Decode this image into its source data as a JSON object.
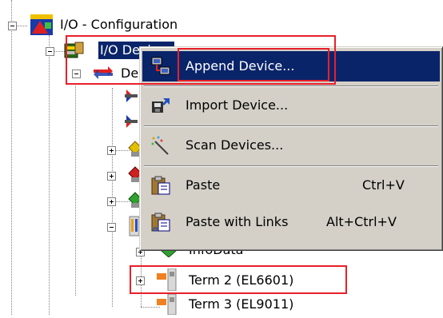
{
  "tree": {
    "root_label": "I/O - Configuration",
    "devices_label": "I/O Devices",
    "device_partial": "De",
    "infodata_label": "InfoData",
    "term2_label": "Term 2 (EL6601)",
    "term3_label": "Term 3 (EL9011)"
  },
  "context_menu": {
    "items": [
      {
        "label": "Append Device...",
        "shortcut": "",
        "icon": "append-device-icon"
      },
      {
        "label": "Import Device...",
        "shortcut": "",
        "icon": "import-device-icon"
      },
      {
        "label": "Scan Devices...",
        "shortcut": "",
        "icon": "scan-devices-icon"
      },
      {
        "label": "Paste",
        "shortcut": "Ctrl+V",
        "icon": "paste-icon"
      },
      {
        "label": "Paste with Links",
        "shortcut": "Alt+Ctrl+V",
        "icon": "paste-links-icon"
      }
    ]
  },
  "colors": {
    "highlight": "#0a246a",
    "annotation_red": "#e8202a",
    "menu_bg": "#d4d0c8"
  }
}
